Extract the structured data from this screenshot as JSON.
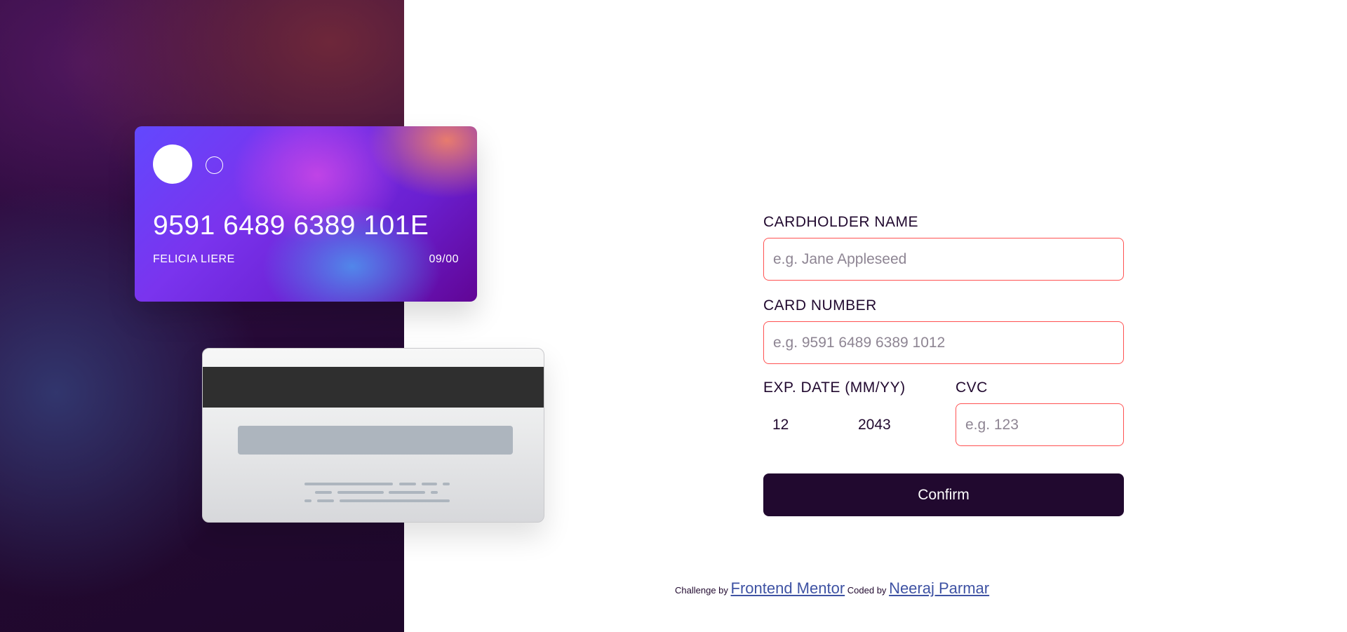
{
  "card": {
    "number": "9591 6489 6389 101E",
    "name": "FELICIA LIERE",
    "expiry": "09/00",
    "cvc": ""
  },
  "form": {
    "cardholder": {
      "label": "CARDHOLDER NAME",
      "placeholder": "e.g. Jane Appleseed",
      "value": ""
    },
    "card_number": {
      "label": "CARD NUMBER",
      "placeholder": "e.g. 9591 6489 6389 1012",
      "value": ""
    },
    "expiry": {
      "label": "EXP. DATE (MM/YY)",
      "month_value": "12",
      "year_value": "2043"
    },
    "cvc": {
      "label": "CVC",
      "placeholder": "e.g. 123",
      "value": ""
    },
    "confirm_label": "Confirm"
  },
  "footer": {
    "challenge_text": "Challenge by",
    "challenge_link": "Frontend Mentor",
    "coded_text": "Coded by",
    "author_link": "Neeraj Parmar"
  },
  "colors": {
    "error_border": "#ff5252",
    "dark_violet": "#21092f",
    "link": "#3e52a3"
  }
}
